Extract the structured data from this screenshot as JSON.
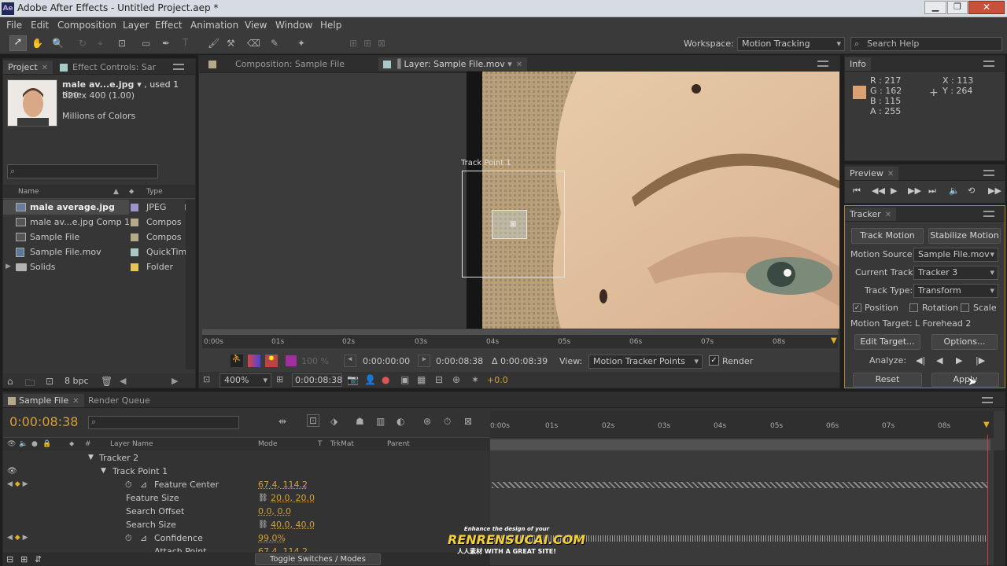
{
  "app": {
    "title": "Adobe After Effects - Untitled Project.aep *",
    "logo": "Ae"
  },
  "menu": [
    "File",
    "Edit",
    "Composition",
    "Layer",
    "Effect",
    "Animation",
    "View",
    "Window",
    "Help"
  ],
  "toolbar": {
    "workspace_label": "Workspace:",
    "workspace_value": "Motion Tracking",
    "search_placeholder": "Search Help"
  },
  "project": {
    "tab": "Project",
    "tab2": "Effect Controls: Sar",
    "item_name": "male av...e.jpg",
    "item_used": "▾ , used 1 time",
    "item_dims": "320 x 400 (1.00)",
    "item_colors": "Millions of Colors",
    "col_name": "Name",
    "col_type": "Type",
    "bpc": "8 bpc",
    "items": [
      {
        "name": "male average.jpg",
        "type": "JPEG",
        "color": "#9d93c8",
        "icon": "image-file-icon"
      },
      {
        "name": "male av...e.jpg Comp 1",
        "type": "Compos",
        "color": "#b6a98a",
        "icon": "composition-icon"
      },
      {
        "name": "Sample File",
        "type": "Compos",
        "color": "#b6a98a",
        "icon": "composition-icon"
      },
      {
        "name": "Sample File.mov",
        "type": "QuickTim",
        "color": "#a9c9c6",
        "icon": "video-file-icon"
      },
      {
        "name": "Solids",
        "type": "Folder",
        "color": "#e6c65a",
        "icon": "folder-icon"
      }
    ]
  },
  "viewer": {
    "tab_comp": "Composition: Sample File",
    "tab_layer": "Layer: Sample File.mov",
    "track_label": "Track Point 1",
    "ruler": [
      "0:00s",
      "01s",
      "02s",
      "03s",
      "04s",
      "05s",
      "06s",
      "07s",
      "08s"
    ],
    "time_in": "0:00:00:00",
    "time_out": "0:00:08:38",
    "duration": "Δ 0:00:08:39",
    "view_label": "View:",
    "view_value": "Motion Tracker Points",
    "render_label": "Render",
    "zoom": "400%",
    "current_time": "0:00:08:38",
    "exposure": "+0.0",
    "resolution": "100 %"
  },
  "info": {
    "tab": "Info",
    "r": "R : 217",
    "g": "G : 162",
    "b": "B : 115",
    "a": "A : 255",
    "x": "X : 113",
    "y": "Y : 264",
    "swatch": "#d9a273"
  },
  "preview": {
    "tab": "Preview"
  },
  "tracker": {
    "tab": "Tracker",
    "track_motion": "Track Motion",
    "stabilize": "Stabilize Motion",
    "motion_source_label": "Motion Source:",
    "motion_source": "Sample File.mov",
    "current_track_label": "Current Track:",
    "current_track": "Tracker 3",
    "track_type_label": "Track Type:",
    "track_type": "Transform",
    "position": "Position",
    "rotation": "Rotation",
    "scale": "Scale",
    "motion_target": "Motion Target: L Forehead 2",
    "edit_target": "Edit Target...",
    "options": "Options...",
    "analyze": "Analyze:",
    "reset": "Reset",
    "apply": "Apply"
  },
  "timeline": {
    "tab": "Sample File",
    "tab2": "Render Queue",
    "timecode": "0:00:08:38",
    "col_num": "#",
    "col_layer": "Layer Name",
    "col_mode": "Mode",
    "col_t": "T",
    "col_trkmat": "TrkMat",
    "col_parent": "Parent",
    "toggle": "Toggle Switches / Modes",
    "ruler": [
      "0:00s",
      "01s",
      "02s",
      "03s",
      "04s",
      "05s",
      "06s",
      "07s",
      "08s"
    ],
    "rows": [
      {
        "name": "Tracker 2",
        "value": "",
        "indent": 110
      },
      {
        "name": "Track Point 1",
        "value": "",
        "indent": 128
      },
      {
        "name": "Feature Center",
        "value": "67.4, 114.2",
        "indent": 195
      },
      {
        "name": "Feature Size",
        "value": "20.0, 20.0",
        "indent": 158
      },
      {
        "name": "Search Offset",
        "value": "0.0, 0.0",
        "indent": 158
      },
      {
        "name": "Search Size",
        "value": "40.0, 40.0",
        "indent": 158
      },
      {
        "name": "Confidence",
        "value": "99.0%",
        "indent": 195
      },
      {
        "name": "Attach Point",
        "value": "67.4, 114.2",
        "indent": 195
      }
    ]
  },
  "watermark": {
    "top": "Enhance the design of your",
    "main": "RENRENSUCAI.COM",
    "sub": "人人素材 WITH A GREAT SITE!"
  }
}
